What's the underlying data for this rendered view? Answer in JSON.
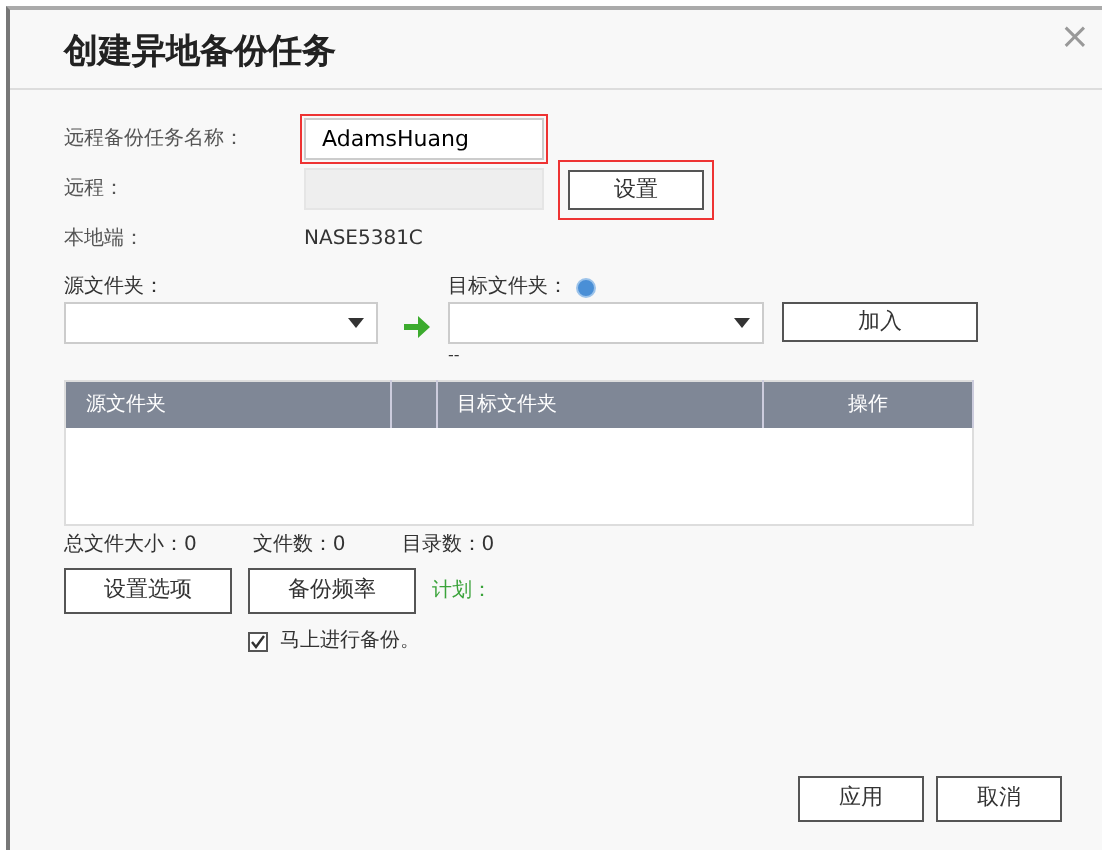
{
  "dialog": {
    "title": "创建异地备份任务",
    "close": "×"
  },
  "fields": [
    {
      "label": "远程备份任务名称：",
      "value": "AdamsHuang",
      "highlighted": true
    },
    {
      "label": "远程：",
      "disabled": true,
      "button": "设置",
      "button_highlighted": true
    },
    {
      "label": "本地端：",
      "text": "NASE5381C"
    }
  ],
  "source": {
    "label": "源文件夹："
  },
  "target": {
    "label": "目标文件夹：",
    "note": "--"
  },
  "add_button": "加入",
  "table": {
    "columns": [
      "源文件夹",
      "",
      "目标文件夹",
      "操作"
    ]
  },
  "stats": [
    "总文件大小：0",
    "文件数：0",
    "目录数：0"
  ],
  "option_buttons": [
    "设置选项",
    "备份频率"
  ],
  "schedule": "计划：",
  "backup_now": {
    "label": "马上进行备份。",
    "checked": true
  },
  "footer_buttons": [
    "应用",
    "取消"
  ]
}
